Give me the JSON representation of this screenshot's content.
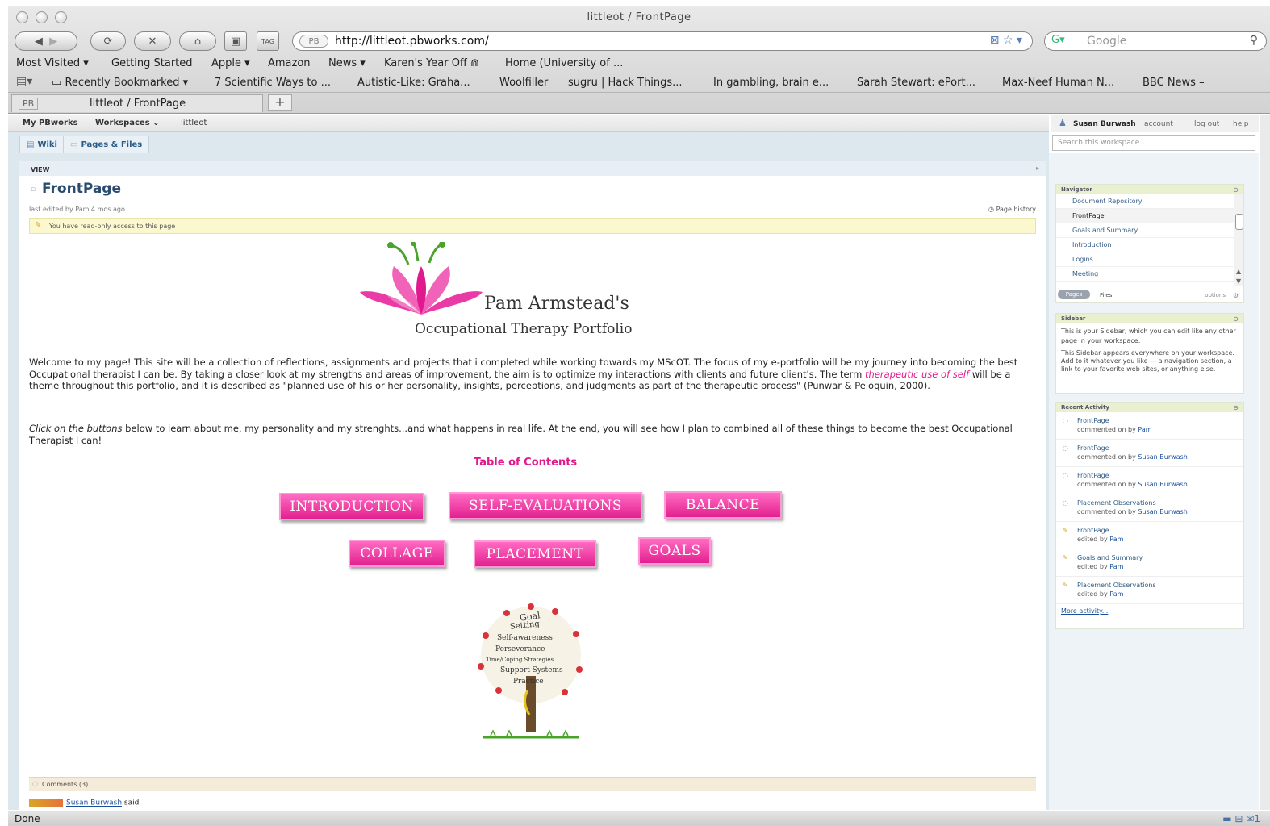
{
  "browser": {
    "window_title": "littleot / FrontPage",
    "url": "http://littleot.pbworks.com/",
    "search_placeholder": "Google",
    "url_badge": "PB",
    "bookmarks_row1": [
      "Most Visited ▾",
      "Getting Started",
      "Apple ▾",
      "Amazon",
      "News ▾",
      "Karen's Year Off ⋒",
      "Home (University of ..."
    ],
    "bookmarks_row2": [
      "Recently Bookmarked ▾",
      "7 Scientific Ways to ...",
      "Autistic-Like: Graha...",
      "Woolfiller",
      "sugru | Hack Things...",
      "In gambling, brain e...",
      "Sarah Stewart: ePort...",
      "Max-Neef Human N...",
      "BBC News –"
    ],
    "tab_label": "littleot / FrontPage",
    "tab_badge": "PB",
    "new_tab": "+",
    "status": "Done"
  },
  "pbworks": {
    "breadcrumb": [
      "My PBworks",
      "Workspaces ⌄",
      "littleot"
    ],
    "user": "Susan Burwash",
    "user_links": [
      "account",
      "log out",
      "help"
    ],
    "tabs": [
      "Wiki",
      "Pages & Files"
    ],
    "search_placeholder": "Search this workspace"
  },
  "page": {
    "view_tab": "VIEW",
    "title": "FrontPage",
    "last_edited": "last edited by  Pam     4 mos ago",
    "page_history": "Page history",
    "readonly_notice": "You have read-only access to this page",
    "logo_name": "Pam Armstead's",
    "logo_subtitle": "Occupational Therapy Portfolio",
    "welcome_part1": "Welcome to my page! This site will be a collection of reflections, assignments and projects that i completed while working towards my MScOT. The focus of my e-portfolio will be my journey into becoming the best Occupational therapist I can be. By taking a closer look at my strengths and areas of improvement, the aim is to optimize my interactions with clients and future client's. The term ",
    "welcome_highlight": "therapeutic use of self",
    "welcome_part2": " will be a theme throughout this portfolio, and it is described as \"planned use of his or her personality, insights, perceptions, and judgments as part of the therapeutic process\" (Punwar & Peloquin, 2000).",
    "click_italic": "Click on the buttons",
    "click_rest": " below to learn about me, my personality and my strenghts...and what happens in real life. At the end, you will see how I plan to combined all of these things to become the best Occupational Therapist I can!",
    "toc_title": "Table of Contents",
    "buttons": {
      "introduction": "INTRODUCTION",
      "self_evaluations": "SELF-EVALUATIONS",
      "balance": "BALANCE",
      "collage": "COLLAGE",
      "placement": "PLACEMENT",
      "goals": "GOALS"
    },
    "tree_words": [
      "Goal",
      "Setting",
      "Self-awareness",
      "Perseverance",
      "Time/Coping Strategies",
      "Support Systems",
      "Practice"
    ],
    "comments": "Comments (3)",
    "commenter": "Susan Burwash",
    "commenter_said": "said"
  },
  "navigator": {
    "title": "Navigator",
    "items": [
      "Document Repository",
      "FrontPage",
      "Goals and Summary",
      "Introduction",
      "Logins",
      "Meeting"
    ],
    "tabs": [
      "Pages",
      "Files"
    ],
    "options": "options"
  },
  "sidebar": {
    "title": "Sidebar",
    "text1": "This is your Sidebar, which you can edit like any other page in your workspace.",
    "text2": "This Sidebar appears everywhere on your workspace. Add to it whatever you like — a navigation section, a link to your favorite web sites, or anything else."
  },
  "recent_activity": {
    "title": "Recent Activity",
    "items": [
      {
        "title": "FrontPage",
        "action": "commented on by ",
        "who": "Pam"
      },
      {
        "title": "FrontPage",
        "action": "commented on by ",
        "who": "Susan Burwash"
      },
      {
        "title": "FrontPage",
        "action": "commented on by ",
        "who": "Susan Burwash"
      },
      {
        "title": "Placement Observations",
        "action": "commented on by ",
        "who": "Susan Burwash"
      },
      {
        "title": "FrontPage",
        "action": "edited by ",
        "who": "Pam"
      },
      {
        "title": "Goals and Summary",
        "action": "edited by ",
        "who": "Pam"
      },
      {
        "title": "Placement Observations",
        "action": "edited by ",
        "who": "Pam"
      }
    ],
    "more": "More activity..."
  },
  "colors": {
    "accent_pink": "#e01a8e",
    "logo_green": "#4aa32a",
    "link_blue": "#1a4f9c"
  }
}
